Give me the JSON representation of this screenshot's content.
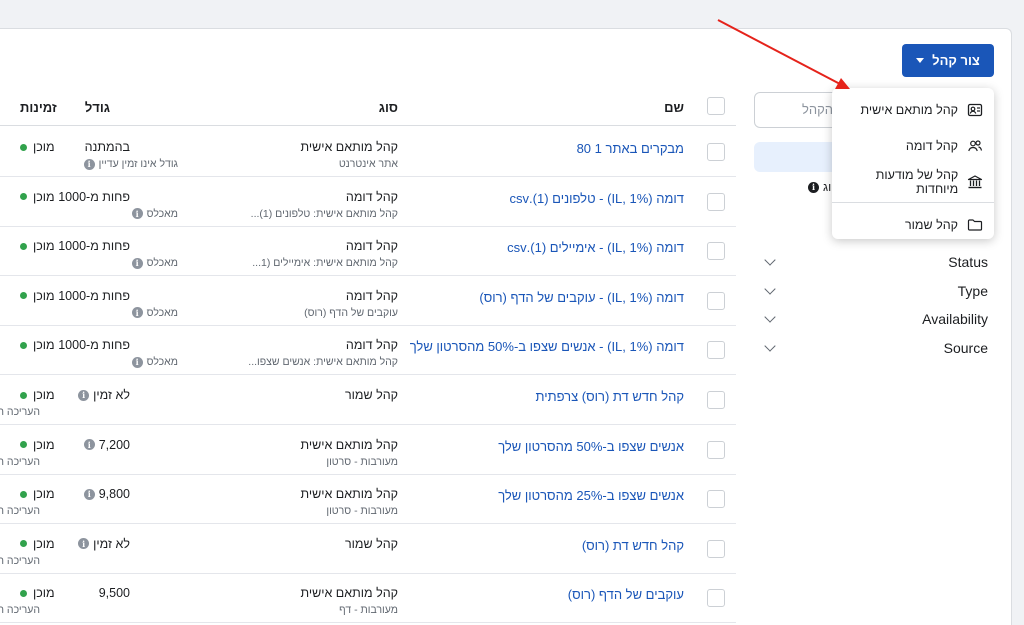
{
  "toolbar": {
    "create_label": "צור קהל"
  },
  "sidebar": {
    "search_placeholder": "הקהל",
    "note_text": "וג",
    "filters": [
      {
        "label": "Status"
      },
      {
        "label": "Type"
      },
      {
        "label": "Availability"
      },
      {
        "label": "Source"
      }
    ]
  },
  "menu": {
    "items": [
      {
        "label": "קהל מותאם אישית",
        "icon": "custom-audience-icon"
      },
      {
        "label": "קהל דומה",
        "icon": "lookalike-people-icon"
      },
      {
        "label": "קהל של מודעות מיוחדות",
        "icon": "bank-icon"
      },
      {
        "label": "קהל שמור",
        "icon": "folder-icon"
      }
    ]
  },
  "table": {
    "headers": {
      "name": "שם",
      "type": "סוג",
      "size": "גודל",
      "availability": "זמינות"
    },
    "rows": [
      {
        "name": "מבקרים באתר 1 80",
        "type": "קהל מותאם אישית",
        "type_sub": "אתר אינטרנט",
        "size": "בהמתנה",
        "size_sub": "גודל אינו זמין עדיין",
        "size_info": false,
        "sub_info": true,
        "availability": "מוכן",
        "avail_sub": ""
      },
      {
        "name": "דומה (IL, 1%) - טלפונים (1).csv",
        "type": "קהל דומה",
        "type_sub": "קהל מותאם אישית: טלפונים (1)...",
        "size": "פחות מ-1000",
        "size_sub": "מאכלס",
        "size_info": false,
        "sub_info": true,
        "availability": "מוכן",
        "avail_sub": ""
      },
      {
        "name": "דומה (IL, 1%) - אימיילים (1).csv",
        "type": "קהל דומה",
        "type_sub": "קהל מותאם אישית: אימיילים (1...",
        "size": "פחות מ-1000",
        "size_sub": "מאכלס",
        "size_info": false,
        "sub_info": true,
        "availability": "מוכן",
        "avail_sub": ""
      },
      {
        "name": "דומה (IL, 1%) - עוקבים של הדף (רוס)",
        "type": "קהל דומה",
        "type_sub": "עוקבים של הדף (רוס)",
        "size": "פחות מ-1000",
        "size_sub": "מאכלס",
        "size_info": false,
        "sub_info": true,
        "availability": "מוכן",
        "avail_sub": ""
      },
      {
        "name": "דומה (IL, 1%) - אנשים שצפו ב-50% מהסרטון שלך",
        "type": "קהל דומה",
        "type_sub": "קהל מותאם אישית: אנשים שצפו...",
        "size": "פחות מ-1000",
        "size_sub": "מאכלס",
        "size_info": false,
        "sub_info": true,
        "availability": "מוכן",
        "avail_sub": ""
      },
      {
        "name": "קהל חדש דת (רוס) צרפתית",
        "type": "קהל שמור",
        "type_sub": "",
        "size": "לא זמין",
        "size_sub": "",
        "size_info": true,
        "sub_info": false,
        "availability": "מוכן",
        "avail_sub": "העריכה ה"
      },
      {
        "name": "אנשים שצפו ב-50% מהסרטון שלך",
        "type": "קהל מותאם אישית",
        "type_sub": "מעורבות - סרטון",
        "size": "7,200",
        "size_sub": "",
        "size_info": true,
        "sub_info": false,
        "availability": "מוכן",
        "avail_sub": "העריכה ה"
      },
      {
        "name": "אנשים שצפו ב-25% מהסרטון שלך",
        "type": "קהל מותאם אישית",
        "type_sub": "מעורבות - סרטון",
        "size": "9,800",
        "size_sub": "",
        "size_info": true,
        "sub_info": false,
        "availability": "מוכן",
        "avail_sub": "העריכה ה"
      },
      {
        "name": "קהל חדש דת (רוס)",
        "type": "קהל שמור",
        "type_sub": "",
        "size": "לא זמין",
        "size_sub": "",
        "size_info": true,
        "sub_info": false,
        "availability": "מוכן",
        "avail_sub": "העריכה ה"
      },
      {
        "name": "עוקבים של הדף (רוס)",
        "type": "קהל מותאם אישית",
        "type_sub": "מעורבות - דף",
        "size": "9,500",
        "size_sub": "",
        "size_info": false,
        "sub_info": false,
        "availability": "מוכן",
        "avail_sub": "העריכה ה"
      }
    ]
  },
  "colors": {
    "accent": "#1a56b8",
    "ready_dot": "#31a24c",
    "annotation_arrow": "#e5231b"
  }
}
